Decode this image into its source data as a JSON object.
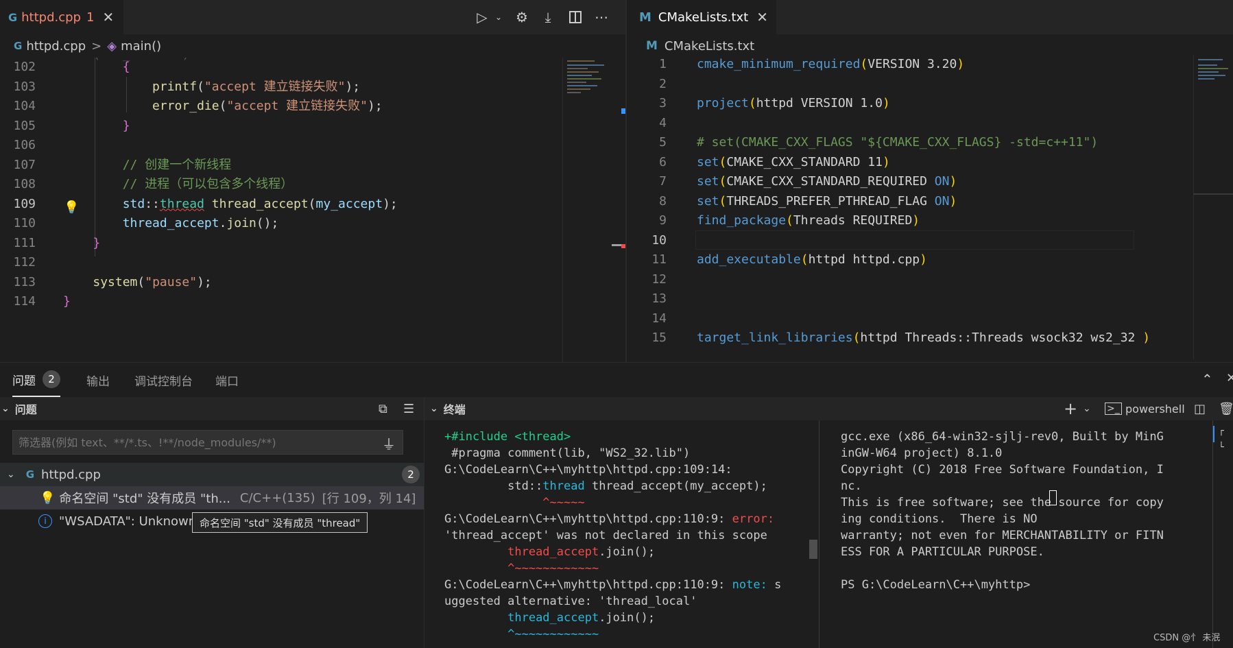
{
  "left_editor": {
    "tab": {
      "icon": "c-plus-plus-icon",
      "title": "httpd.cpp",
      "problems": "1"
    },
    "breadcrumb": {
      "file": "httpd.cpp",
      "separator": ">",
      "symbol": "main()"
    },
    "lines": [
      {
        "n": "102",
        "text": "        {"
      },
      {
        "n": "103",
        "text": "            printf(\"accept 建立链接失败\");"
      },
      {
        "n": "104",
        "text": "            error_die(\"accept 建立链接失败\");"
      },
      {
        "n": "105",
        "text": "        }"
      },
      {
        "n": "106",
        "text": ""
      },
      {
        "n": "107",
        "text": "        // 创建一个新线程"
      },
      {
        "n": "108",
        "text": "        // 进程（可以包含多个线程）"
      },
      {
        "n": "109",
        "text": "        std::thread thread_accept(my_accept);"
      },
      {
        "n": "110",
        "text": "        thread_accept.join();"
      },
      {
        "n": "111",
        "text": "    }"
      },
      {
        "n": "112",
        "text": ""
      },
      {
        "n": "113",
        "text": "    system(\"pause\");"
      },
      {
        "n": "114",
        "text": "}"
      }
    ],
    "current_line": "109"
  },
  "right_editor": {
    "tab": {
      "icon": "cmake-m-icon",
      "title": "CMakeLists.txt"
    },
    "breadcrumb": {
      "file": "CMakeLists.txt"
    },
    "lines": [
      {
        "n": "1",
        "text": "cmake_minimum_required(VERSION 3.20)"
      },
      {
        "n": "2",
        "text": ""
      },
      {
        "n": "3",
        "text": "project(httpd VERSION 1.0)"
      },
      {
        "n": "4",
        "text": ""
      },
      {
        "n": "5",
        "text": "# set(CMAKE_CXX_FLAGS \"${CMAKE_CXX_FLAGS} -std=c++11\")"
      },
      {
        "n": "6",
        "text": "set(CMAKE_CXX_STANDARD 11)"
      },
      {
        "n": "7",
        "text": "set(CMAKE_CXX_STANDARD_REQUIRED ON)"
      },
      {
        "n": "8",
        "text": "set(THREADS_PREFER_PTHREAD_FLAG ON)"
      },
      {
        "n": "9",
        "text": "find_package(Threads REQUIRED)"
      },
      {
        "n": "10",
        "text": ""
      },
      {
        "n": "11",
        "text": "add_executable(httpd httpd.cpp)"
      },
      {
        "n": "12",
        "text": ""
      },
      {
        "n": "13",
        "text": ""
      },
      {
        "n": "14",
        "text": ""
      },
      {
        "n": "15",
        "text": "target_link_libraries(httpd Threads::Threads wsock32 ws2_32 )"
      }
    ],
    "current_line": "10"
  },
  "panel": {
    "tabs": [
      {
        "label": "问题",
        "badge": "2"
      },
      {
        "label": "输出"
      },
      {
        "label": "调试控制台"
      },
      {
        "label": "端口"
      }
    ],
    "problems": {
      "header": "问题",
      "filter_placeholder": "筛选器(例如 text、**/*.ts、!**/node_modules/**)",
      "file": "httpd.cpp",
      "file_count": "2",
      "items": [
        {
          "icon": "lightbulb-icon",
          "message": "命名空间 \"std\" 没有成员 \"th...",
          "source": "C/C++(135)",
          "location": "[行 109，列 14]"
        },
        {
          "icon": "info-icon",
          "message": "\"WSADATA\": Unknown"
        }
      ],
      "tooltip": "命名空间 \"std\" 没有成员 \"thread\""
    },
    "terminal": {
      "header": "终端",
      "shell": "powershell",
      "left_lines": [
        "+#include <thread>",
        " #pragma comment(lib, \"WS2_32.lib\")",
        "G:\\CodeLearn\\C++\\myhttp\\httpd.cpp:109:14:",
        "         std::thread thread_accept(my_accept);",
        "              ^~~~~~",
        "G:\\CodeLearn\\C++\\myhttp\\httpd.cpp:110:9: error:",
        "'thread_accept' was not declared in this scope",
        "         thread_accept.join();",
        "         ^~~~~~~~~~~~~",
        "G:\\CodeLearn\\C++\\myhttp\\httpd.cpp:110:9: note: s",
        "uggested alternative: 'thread_local'",
        "         thread_accept.join();",
        "         ^~~~~~~~~~~~~"
      ],
      "right_lines": [
        "gcc.exe (x86_64-win32-sjlj-rev0, Built by MinG",
        "inGW-W64 project) 8.1.0",
        "Copyright (C) 2018 Free Software Foundation, I",
        "nc.",
        "This is free software; see the source for copy",
        "ing conditions.  There is NO",
        "warranty; not even for MERCHANTABILITY or FITN",
        "ESS FOR A PARTICULAR PURPOSE.",
        "",
        "PS G:\\CodeLearn\\C++\\myhttp>"
      ]
    }
  },
  "watermark": "CSDN @忄 未泯"
}
